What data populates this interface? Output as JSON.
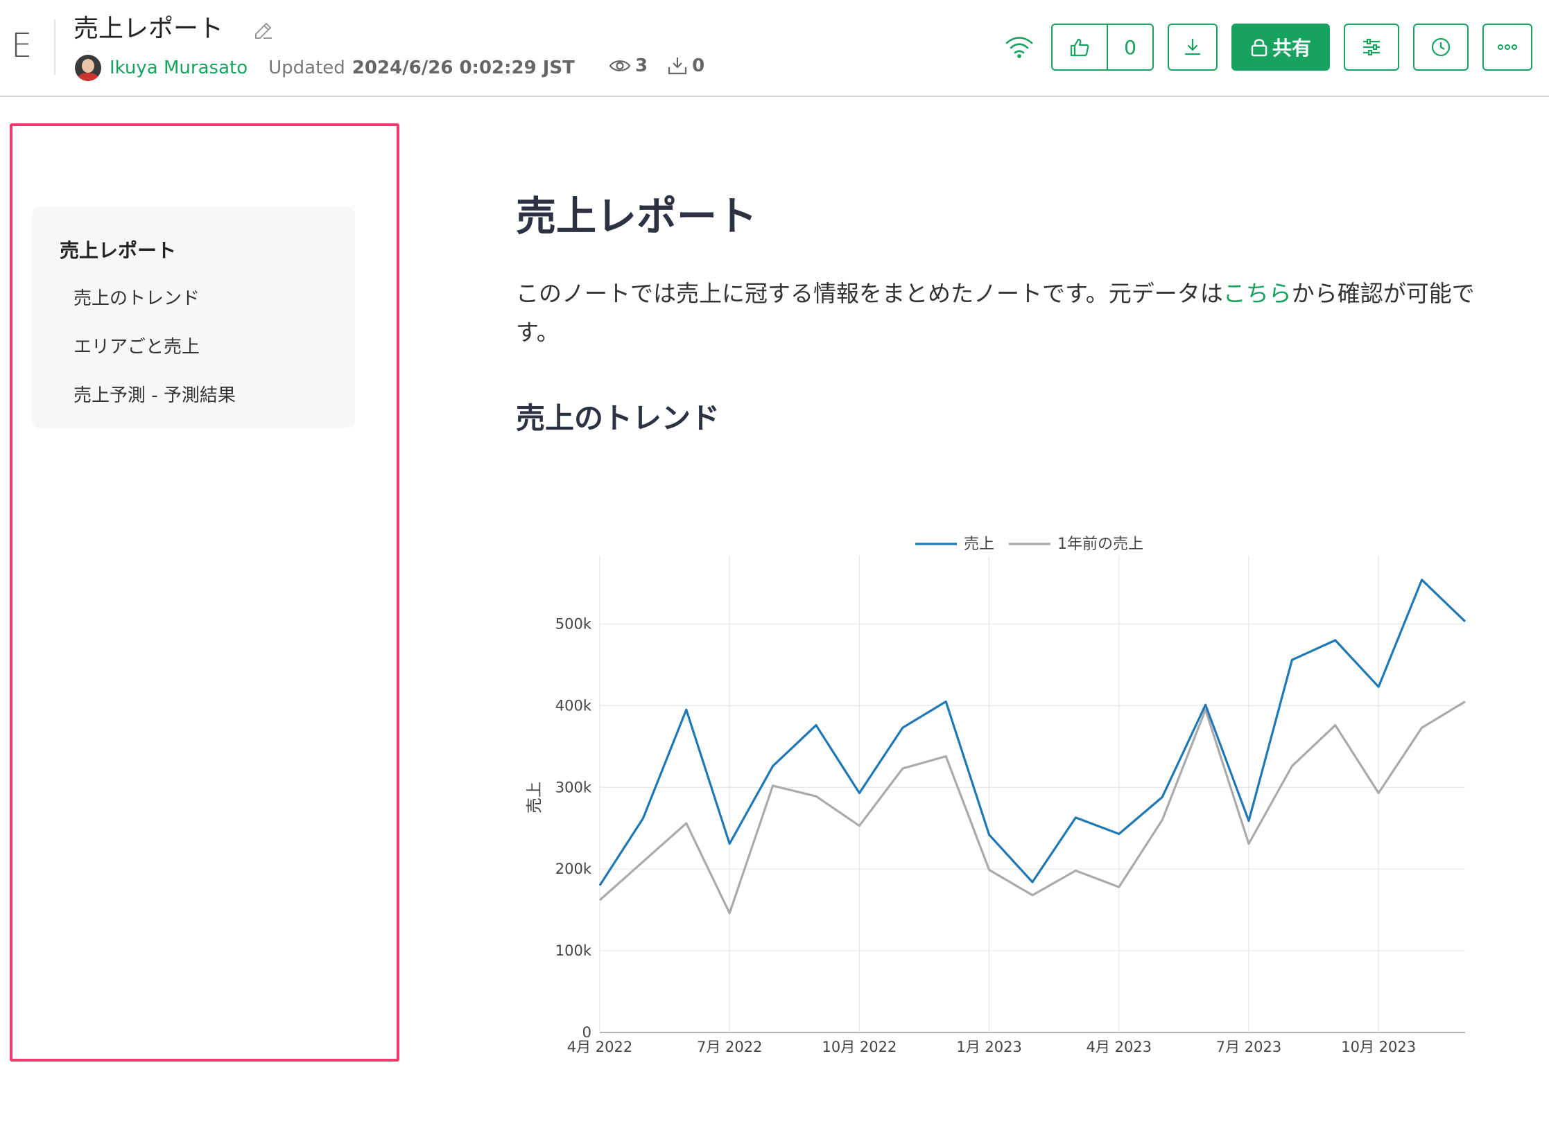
{
  "header": {
    "logo": "E",
    "title": "売上レポート",
    "author": "Ikuya Murasato",
    "updated_label": "Updated",
    "updated_time": "2024/6/26 0:02:29 JST",
    "views": "3",
    "downloads": "0",
    "like_count": "0",
    "share_label": "共有",
    "accent_color": "#17a35f"
  },
  "toc": {
    "title": "売上レポート",
    "items": [
      {
        "label": "売上のトレンド"
      },
      {
        "label": "エリアごと売上"
      },
      {
        "label": "売上予測 - 予測結果"
      }
    ]
  },
  "main": {
    "title": "売上レポート",
    "intro_before": "このノートでは売上に冠する情報をまとめたノートです。元データは",
    "intro_link": "こちら",
    "intro_after": "から確認が可能です。",
    "section_title": "売上のトレンド"
  },
  "chart_data": {
    "type": "line",
    "title": "",
    "xlabel": "",
    "ylabel": "売上",
    "x": [
      "2022-04",
      "2022-05",
      "2022-06",
      "2022-07",
      "2022-08",
      "2022-09",
      "2022-10",
      "2022-11",
      "2022-12",
      "2023-01",
      "2023-02",
      "2023-03",
      "2023-04",
      "2023-05",
      "2023-06",
      "2023-07",
      "2023-08",
      "2023-09",
      "2023-10",
      "2023-11",
      "2023-12"
    ],
    "x_ticks": [
      "4月 2022",
      "7月 2022",
      "10月 2022",
      "1月 2023",
      "4月 2023",
      "7月 2023",
      "10月 2023"
    ],
    "y_ticks": [
      "0",
      "100k",
      "200k",
      "300k",
      "400k",
      "500k"
    ],
    "ylim": [
      0,
      575000
    ],
    "grid": true,
    "legend_position": "top-center",
    "series": [
      {
        "name": "売上",
        "color": "#1f77b4",
        "values": [
          180000,
          262000,
          395000,
          231000,
          326000,
          376000,
          293000,
          373000,
          405000,
          242000,
          184000,
          263000,
          243000,
          288000,
          401000,
          259000,
          456000,
          480000,
          423000,
          554000,
          503000
        ]
      },
      {
        "name": "1年前の売上",
        "color": "#aaaaaa",
        "values": [
          162000,
          209000,
          256000,
          146000,
          302000,
          289000,
          253000,
          323000,
          338000,
          199000,
          168000,
          198000,
          178000,
          260000,
          395000,
          231000,
          326000,
          376000,
          293000,
          373000,
          405000
        ]
      }
    ]
  }
}
